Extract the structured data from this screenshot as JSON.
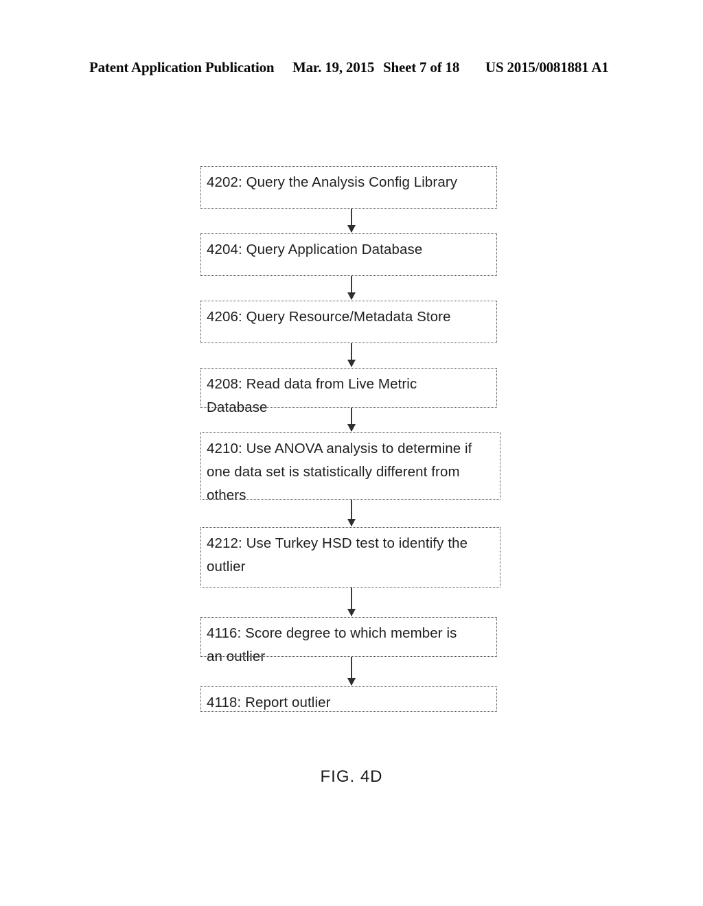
{
  "page": {
    "background_color": "#ffffff",
    "ink_color": "#1f1f1f"
  },
  "header": {
    "publication_label": "Patent Application Publication",
    "date": "Mar. 19, 2015",
    "sheet": "Sheet 7 of 18",
    "publication_number": "US 2015/0081881 A1"
  },
  "figure": {
    "caption": "FIG. 4D",
    "type": "flowchart",
    "orientation": "vertical",
    "box_border_style": "dotted",
    "nodes": [
      {
        "id": "4202",
        "label": "4202: Query the Analysis Config Library"
      },
      {
        "id": "4204",
        "label": "4204: Query Application Database"
      },
      {
        "id": "4206",
        "label": "4206: Query Resource/Metadata Store"
      },
      {
        "id": "4208",
        "label": "4208: Read data from Live Metric\nDatabase"
      },
      {
        "id": "4210",
        "label": "4210: Use ANOVA analysis to determine if\none data set is statistically different from\nothers"
      },
      {
        "id": "4212",
        "label": "4212: Use Turkey HSD test to identify the\noutlier"
      },
      {
        "id": "4116",
        "label": "4116: Score degree to which member is\nan outlier"
      },
      {
        "id": "4118",
        "label": "4118: Report outlier"
      }
    ],
    "edges": [
      {
        "from": "4202",
        "to": "4204"
      },
      {
        "from": "4204",
        "to": "4206"
      },
      {
        "from": "4206",
        "to": "4208"
      },
      {
        "from": "4208",
        "to": "4210"
      },
      {
        "from": "4210",
        "to": "4212"
      },
      {
        "from": "4212",
        "to": "4116"
      },
      {
        "from": "4116",
        "to": "4118"
      }
    ]
  }
}
